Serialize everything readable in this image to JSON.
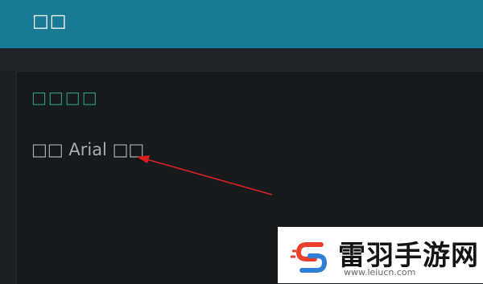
{
  "header": {
    "title": "□□"
  },
  "section": {
    "title": "□□□□",
    "option_label": "□□ Arial □□"
  },
  "watermark": {
    "brand": "雷羽手游网",
    "url": "www.leiucn.com"
  },
  "colors": {
    "header_bg": "#187a95",
    "page_bg": "#1c2024",
    "panel_bg": "#161a1c",
    "section_title": "#2a9a7c",
    "option_text": "#a8adb1",
    "arrow": "#e01e22"
  }
}
